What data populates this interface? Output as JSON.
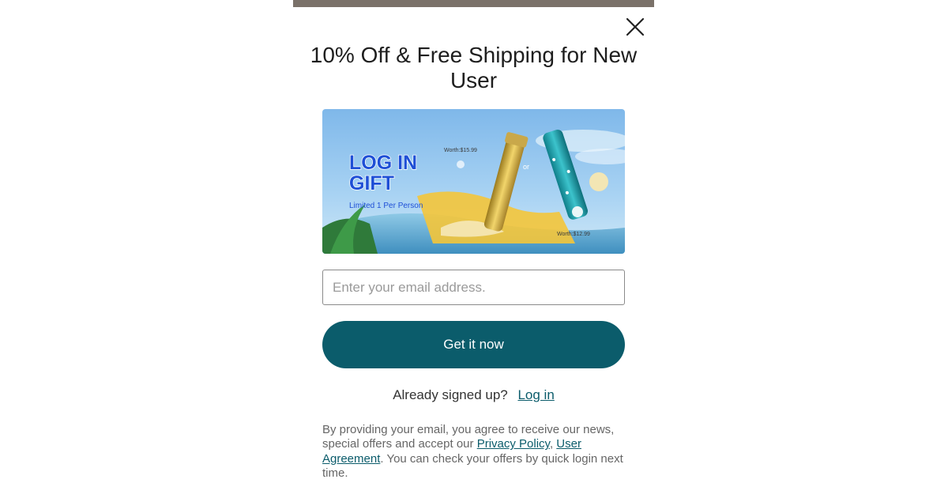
{
  "modal": {
    "close_icon": "close-icon",
    "title": "10% Off & Free Shipping for New User",
    "banner": {
      "headline_line1": "LOG IN",
      "headline_line2": "GIFT",
      "subline": "Limited 1 Per Person",
      "worth_left": "Worth:$15.99",
      "or_label": "or",
      "worth_right": "Worth:$12.99"
    },
    "email_placeholder": "Enter your email address.",
    "cta_label": "Get it now",
    "already_text": "Already signed up?",
    "login_label": "Log in",
    "disclaimer": {
      "part1": "By providing your email, you agree to receive our news, special offers and accept our ",
      "privacy_label": "Privacy Policy",
      "comma": ",",
      "user_agreement_label": "User Agreement",
      "part2": ". You can check your offers by quick login next time."
    }
  },
  "colors": {
    "accent": "#0b5c6b",
    "banner_blue": "#1e4fd6",
    "top_strip": "#7a7169"
  }
}
